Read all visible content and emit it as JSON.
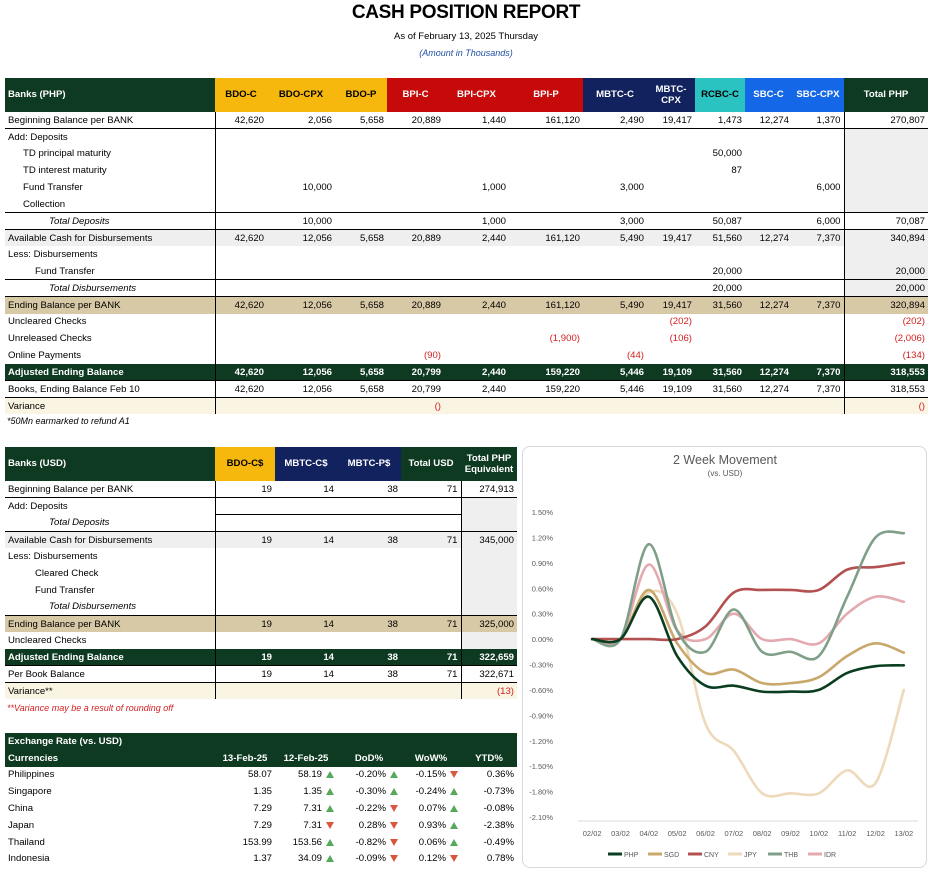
{
  "report": {
    "title": "CASH POSITION REPORT",
    "as_of": "As of February 13, 2025 Thursday",
    "units": "(Amount in Thousands)"
  },
  "php": {
    "headers": [
      "Banks (PHP)",
      "BDO-C",
      "BDO-CPX",
      "BDO-P",
      "BPI-C",
      "BPI-CPX",
      "BPI-P",
      "MBTC-C",
      "MBTC-CPX",
      "RCBC-C",
      "SBC-C",
      "SBC-CPX",
      "Total PHP"
    ],
    "rows": [
      {
        "label": "Beginning Balance per BANK",
        "cells": [
          "42,620",
          "2,056",
          "5,658",
          "20,889",
          "1,440",
          "161,120",
          "2,490",
          "19,417",
          "1,473",
          "12,274",
          "1,370",
          "270,807"
        ]
      },
      {
        "label": "Add: Deposits",
        "cells": [
          "",
          "",
          "",
          "",
          "",
          "",
          "",
          "",
          "",
          "",
          "",
          ""
        ]
      },
      {
        "label": "TD principal maturity",
        "cells": [
          "",
          "",
          "",
          "",
          "",
          "",
          "",
          "",
          "50,000",
          "",
          "",
          ""
        ]
      },
      {
        "label": "TD interest maturity",
        "cells": [
          "",
          "",
          "",
          "",
          "",
          "",
          "",
          "",
          "87",
          "",
          "",
          ""
        ]
      },
      {
        "label": "Fund Transfer",
        "cells": [
          "",
          "10,000",
          "",
          "",
          "1,000",
          "",
          "3,000",
          "",
          "",
          "",
          "6,000",
          ""
        ]
      },
      {
        "label": "Collection",
        "cells": [
          "",
          "",
          "",
          "",
          "",
          "",
          "",
          "",
          "",
          "",
          "",
          ""
        ]
      },
      {
        "label": "Total Deposits",
        "cells": [
          "",
          "10,000",
          "",
          "",
          "1,000",
          "",
          "3,000",
          "",
          "50,087",
          "",
          "6,000",
          "70,087"
        ]
      },
      {
        "label": "Available Cash for Disbursements",
        "cells": [
          "42,620",
          "12,056",
          "5,658",
          "20,889",
          "2,440",
          "161,120",
          "5,490",
          "19,417",
          "51,560",
          "12,274",
          "7,370",
          "340,894"
        ]
      },
      {
        "label": "Less: Disbursements",
        "cells": [
          "",
          "",
          "",
          "",
          "",
          "",
          "",
          "",
          "",
          "",
          "",
          ""
        ]
      },
      {
        "label": "Fund Transfer",
        "cells": [
          "",
          "",
          "",
          "",
          "",
          "",
          "",
          "",
          "20,000",
          "",
          "",
          "20,000"
        ]
      },
      {
        "label": "Total Disbursements",
        "cells": [
          "",
          "",
          "",
          "",
          "",
          "",
          "",
          "",
          "20,000",
          "",
          "",
          "20,000"
        ]
      },
      {
        "label": "Ending Balance per BANK",
        "cells": [
          "42,620",
          "12,056",
          "5,658",
          "20,889",
          "2,440",
          "161,120",
          "5,490",
          "19,417",
          "31,560",
          "12,274",
          "7,370",
          "320,894"
        ]
      },
      {
        "label": "Uncleared Checks",
        "cells": [
          "",
          "",
          "",
          "",
          "",
          "",
          "",
          "(202)",
          "",
          "",
          "",
          "(202)"
        ]
      },
      {
        "label": "Unreleased Checks",
        "cells": [
          "",
          "",
          "",
          "",
          "",
          "(1,900)",
          "",
          "(106)",
          "",
          "",
          "",
          "(2,006)"
        ]
      },
      {
        "label": "Online Payments",
        "cells": [
          "",
          "",
          "",
          "(90)",
          "",
          "",
          "(44)",
          "",
          "",
          "",
          "",
          "(134)"
        ]
      },
      {
        "label": "Adjusted Ending Balance",
        "cells": [
          "42,620",
          "12,056",
          "5,658",
          "20,799",
          "2,440",
          "159,220",
          "5,446",
          "19,109",
          "31,560",
          "12,274",
          "7,370",
          "318,553"
        ]
      },
      {
        "label": "Books, Ending Balance Feb 10",
        "cells": [
          "42,620",
          "12,056",
          "5,658",
          "20,799",
          "2,440",
          "159,220",
          "5,446",
          "19,109",
          "31,560",
          "12,274",
          "7,370",
          "318,553"
        ]
      },
      {
        "label": "Variance",
        "cells": [
          "",
          "",
          "",
          "()",
          "",
          "",
          "",
          "",
          "",
          "",
          "",
          "()"
        ]
      }
    ],
    "footnote": "*50Mn earmarked to refund A1"
  },
  "usd": {
    "headers": [
      "Banks (USD)",
      "BDO-C$",
      "MBTC-C$",
      "MBTC-P$",
      "Total USD",
      "Total PHP Equivalent"
    ],
    "rows": [
      {
        "label": "Beginning Balance per BANK",
        "cells": [
          "19",
          "14",
          "38",
          "71",
          "274,913"
        ]
      },
      {
        "label": "Add: Deposits",
        "cells": [
          "",
          "",
          "",
          "",
          ""
        ]
      },
      {
        "label": "Total Deposits",
        "cells": [
          "",
          "",
          "",
          "",
          ""
        ]
      },
      {
        "label": "Available Cash for Disbursements",
        "cells": [
          "19",
          "14",
          "38",
          "71",
          "345,000"
        ]
      },
      {
        "label": "Less: Disbursements",
        "cells": [
          "",
          "",
          "",
          "",
          ""
        ]
      },
      {
        "label": "Cleared Check",
        "cells": [
          "",
          "",
          "",
          "",
          ""
        ]
      },
      {
        "label": "Fund Transfer",
        "cells": [
          "",
          "",
          "",
          "",
          ""
        ]
      },
      {
        "label": "Total Disbursements",
        "cells": [
          "",
          "",
          "",
          "",
          ""
        ]
      },
      {
        "label": "Ending Balance per BANK",
        "cells": [
          "19",
          "14",
          "38",
          "71",
          "325,000"
        ]
      },
      {
        "label": "Uncleared Checks",
        "cells": [
          "",
          "",
          "",
          "",
          ""
        ]
      },
      {
        "label": "Adjusted Ending Balance",
        "cells": [
          "19",
          "14",
          "38",
          "71",
          "322,659"
        ]
      },
      {
        "label": "Per Book Balance",
        "cells": [
          "19",
          "14",
          "38",
          "71",
          "322,671"
        ]
      },
      {
        "label": "Variance**",
        "cells": [
          "",
          "",
          "",
          "",
          "(13)"
        ]
      }
    ],
    "footnote": "**Variance  may be a result of rounding off"
  },
  "fx": {
    "title": "Exchange Rate (vs. USD)",
    "headers": [
      "Currencies",
      "13-Feb-25",
      "12-Feb-25",
      "DoD%",
      "WoW%",
      "YTD%"
    ],
    "rows": [
      {
        "currency": "Philippines",
        "d1": "58.07",
        "d2": "58.19",
        "dod": "-0.20%",
        "dod_dir": "up",
        "wow": "-0.15%",
        "wow_dir": "up",
        "ytd": "0.36%",
        "ytd_dir": "down"
      },
      {
        "currency": "Singapore",
        "d1": "1.35",
        "d2": "1.35",
        "dod": "-0.30%",
        "dod_dir": "up",
        "wow": "-0.24%",
        "wow_dir": "up",
        "ytd": "-0.73%",
        "ytd_dir": "up"
      },
      {
        "currency": "China",
        "d1": "7.29",
        "d2": "7.31",
        "dod": "-0.22%",
        "dod_dir": "up",
        "wow": "0.07%",
        "wow_dir": "down",
        "ytd": "-0.08%",
        "ytd_dir": "up"
      },
      {
        "currency": "Japan",
        "d1": "7.29",
        "d2": "7.31",
        "dod": "0.28%",
        "dod_dir": "down",
        "wow": "0.93%",
        "wow_dir": "down",
        "ytd": "-2.38%",
        "ytd_dir": "up"
      },
      {
        "currency": "Thailand",
        "d1": "153.99",
        "d2": "153.56",
        "dod": "-0.82%",
        "dod_dir": "up",
        "wow": "0.06%",
        "wow_dir": "down",
        "ytd": "-0.49%",
        "ytd_dir": "up"
      },
      {
        "currency": "Indonesia",
        "d1": "1.37",
        "d2": "34.09",
        "dod": "-0.09%",
        "dod_dir": "up",
        "wow": "0.12%",
        "wow_dir": "down",
        "ytd": "0.78%",
        "ytd_dir": "down"
      }
    ],
    "arrow_colors": {
      "up": "#56a85a",
      "down": "#d8573e"
    }
  },
  "chart_data": {
    "type": "line",
    "title": "2 Week Movement",
    "subtitle": "(vs. USD)",
    "x": [
      "02/02",
      "03/02",
      "04/02",
      "05/02",
      "06/02",
      "07/02",
      "08/02",
      "09/02",
      "10/02",
      "11/02",
      "12/02",
      "13/02"
    ],
    "ylim": [
      -2.1,
      1.5
    ],
    "yticks": [
      "1.50%",
      "1.20%",
      "0.90%",
      "0.60%",
      "0.30%",
      "0.00%",
      "-0.30%",
      "-0.60%",
      "-0.90%",
      "-1.20%",
      "-1.50%",
      "-1.80%",
      "-2.10%"
    ],
    "legend_position": "bottom",
    "series": [
      {
        "name": "PHP",
        "color": "#0b3d20",
        "values": [
          0,
          0,
          0.5,
          -0.2,
          -0.55,
          -0.55,
          -0.62,
          -0.62,
          -0.6,
          -0.4,
          -0.32,
          -0.31
        ]
      },
      {
        "name": "SGD",
        "color": "#c8a86b",
        "values": [
          0,
          0,
          0.58,
          -0.05,
          -0.4,
          -0.36,
          -0.52,
          -0.52,
          -0.45,
          -0.2,
          -0.05,
          -0.16
        ]
      },
      {
        "name": "CNY",
        "color": "#b35050",
        "values": [
          0,
          0,
          0,
          0,
          0.15,
          0.55,
          0.58,
          0.58,
          0.58,
          0.82,
          0.85,
          0.9
        ]
      },
      {
        "name": "JPY",
        "color": "#eed9bb",
        "values": [
          0,
          0,
          0.55,
          0.3,
          -1.0,
          -1.32,
          -1.82,
          -1.82,
          -1.82,
          -1.55,
          -1.7,
          -0.6
        ]
      },
      {
        "name": "THB",
        "color": "#7f9f88",
        "values": [
          0,
          0,
          1.12,
          0.1,
          -0.15,
          0.35,
          -0.15,
          -0.15,
          -0.2,
          0.5,
          1.2,
          1.25
        ]
      },
      {
        "name": "IDR",
        "color": "#e4aab0",
        "values": [
          0,
          0,
          0.88,
          0.1,
          0.0,
          0.3,
          0,
          0,
          -0.05,
          0.3,
          0.5,
          0.44
        ]
      }
    ]
  }
}
